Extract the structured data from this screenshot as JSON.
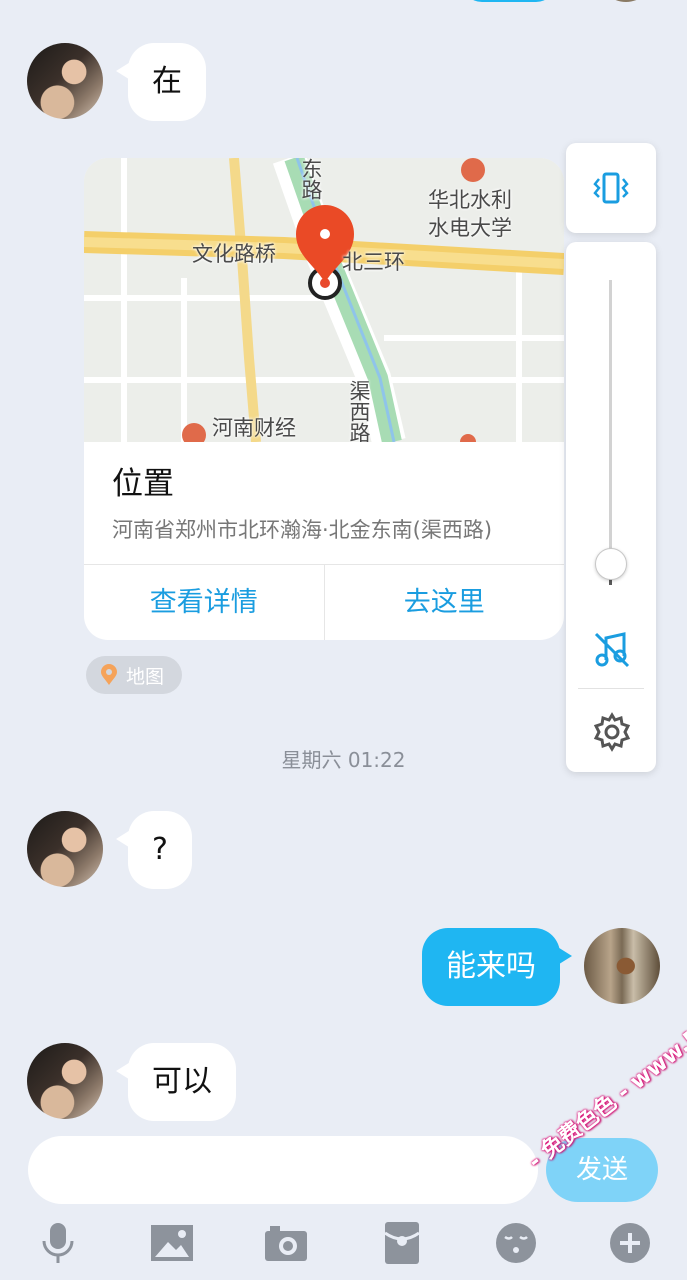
{
  "messages": {
    "m1": "在",
    "m2": "?",
    "m3": "能来吗",
    "m4": "可以"
  },
  "location_card": {
    "title": "位置",
    "address": "河南省郑州市北环瀚海·北金东南(渠西路)",
    "details_label": "查看详情",
    "go_label": "去这里",
    "map_labels": {
      "east_road": "东路",
      "university_line1": "华北水利",
      "university_line2": "水电大学",
      "bridge": "文化路桥",
      "ring": "北三环",
      "canal_road": "渠西路",
      "finance": "河南财经"
    }
  },
  "map_chip_label": "地图",
  "timestamp": "星期六 01:22",
  "send_label": "发送",
  "watermark": "- 免费色色 - www.MFsese.com",
  "volume": {
    "level": 0.07
  },
  "colors": {
    "accent": "#1fb6f2",
    "link": "#1a9de0",
    "background": "#e9edf5",
    "icon": "#1a9de0"
  },
  "icons": {
    "vibrate": "vibrate-icon",
    "music_muted": "music-off-icon",
    "settings": "gear-icon",
    "mic": "microphone-icon",
    "image": "image-icon",
    "camera": "camera-icon",
    "red_packet": "red-packet-icon",
    "emoji": "emoji-icon",
    "plus": "plus-icon",
    "pin": "location-pin-icon"
  }
}
